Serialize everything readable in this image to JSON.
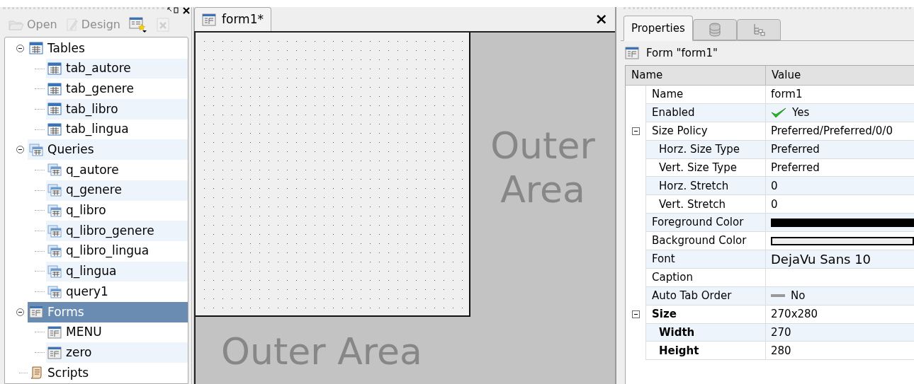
{
  "toolbar": {
    "buttons": [
      {
        "label": "Open",
        "kind": "open",
        "disabled": true
      },
      {
        "label": "Design",
        "kind": "design",
        "disabled": true
      },
      {
        "kind": "new-form",
        "disabled": false
      },
      {
        "kind": "delete",
        "disabled": true
      }
    ]
  },
  "tree": [
    {
      "label": "Tables",
      "kind": "table",
      "expanded": true,
      "selected": false,
      "children": [
        {
          "label": "tab_autore",
          "kind": "table",
          "selected": false
        },
        {
          "label": "tab_genere",
          "kind": "table",
          "selected": false
        },
        {
          "label": "tab_libro",
          "kind": "table",
          "selected": false
        },
        {
          "label": "tab_lingua",
          "kind": "table",
          "selected": false
        }
      ]
    },
    {
      "label": "Queries",
      "kind": "query",
      "expanded": true,
      "selected": false,
      "children": [
        {
          "label": "q_autore",
          "kind": "query",
          "selected": false
        },
        {
          "label": "q_genere",
          "kind": "query",
          "selected": false
        },
        {
          "label": "q_libro",
          "kind": "query",
          "selected": false
        },
        {
          "label": "q_libro_genere",
          "kind": "query",
          "selected": false
        },
        {
          "label": "q_libro_lingua",
          "kind": "query",
          "selected": false
        },
        {
          "label": "q_lingua",
          "kind": "query",
          "selected": false
        },
        {
          "label": "query1",
          "kind": "query",
          "selected": false
        }
      ]
    },
    {
      "label": "Forms",
      "kind": "form",
      "expanded": true,
      "selected": true,
      "children": [
        {
          "label": "MENU",
          "kind": "form",
          "selected": false
        },
        {
          "label": "zero",
          "kind": "form",
          "selected": false
        }
      ]
    },
    {
      "label": "Scripts",
      "kind": "script",
      "selected": false
    }
  ],
  "editor": {
    "tab": {
      "label": "form1*"
    },
    "close": "×",
    "outer_right": [
      "Outer",
      "Area"
    ],
    "outer_bottom": "Outer Area"
  },
  "properties": {
    "tabs": [
      {
        "label": "Properties",
        "kind": "text",
        "selected": true
      },
      {
        "kind": "database",
        "selected": false
      },
      {
        "kind": "tree",
        "selected": false
      }
    ],
    "object": "Form \"form1\"",
    "columns": [
      "Name",
      "Value"
    ],
    "rows": [
      {
        "name": "Name",
        "kind": "text",
        "value": "form1",
        "bold": false
      },
      {
        "name": "Enabled",
        "kind": "check",
        "value": "Yes",
        "bold": false
      },
      {
        "name": "Size Policy",
        "kind": "text",
        "value": "Preferred/Preferred/0/0",
        "bold": false,
        "expanded": true,
        "children": [
          {
            "name": "Horz. Size Type",
            "kind": "text",
            "value": "Preferred",
            "bold": false
          },
          {
            "name": "Vert. Size Type",
            "kind": "text",
            "value": "Preferred",
            "bold": false
          },
          {
            "name": "Horz. Stretch",
            "kind": "text",
            "value": "0",
            "bold": false
          },
          {
            "name": "Vert. Stretch",
            "kind": "text",
            "value": "0",
            "bold": false
          }
        ]
      },
      {
        "name": "Foreground Color",
        "kind": "swatch",
        "color": "#000000",
        "bold": false
      },
      {
        "name": "Background Color",
        "kind": "swatch",
        "color": "#eeeeee",
        "bold": false
      },
      {
        "name": "Font",
        "kind": "font",
        "value": "DejaVu Sans 10",
        "bold": false
      },
      {
        "name": "Caption",
        "kind": "text",
        "bold": false
      },
      {
        "name": "Auto Tab Order",
        "kind": "off",
        "value": "No",
        "bold": false
      },
      {
        "name": "Size",
        "kind": "text",
        "value": "270x280",
        "bold": true,
        "expanded": true,
        "children": [
          {
            "name": "Width",
            "kind": "text",
            "value": "270",
            "bold": true
          },
          {
            "name": "Height",
            "kind": "text",
            "value": "280",
            "bold": true
          }
        ]
      }
    ]
  }
}
